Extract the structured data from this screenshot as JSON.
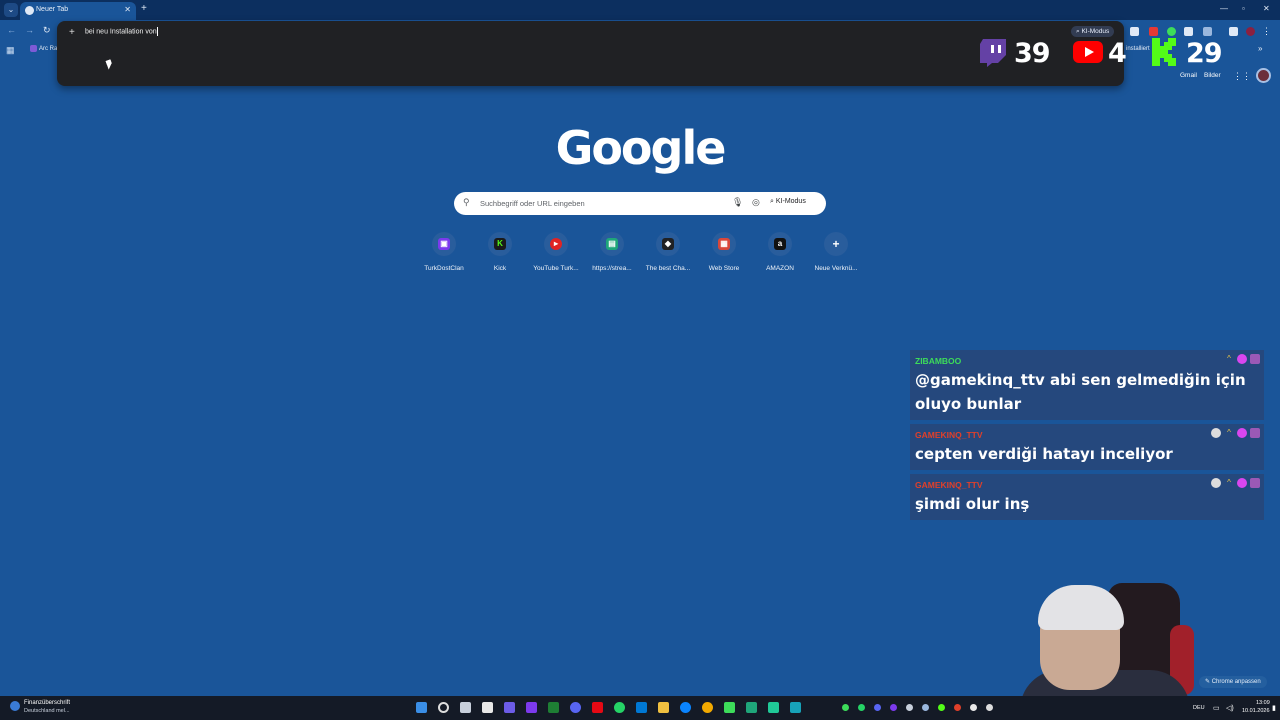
{
  "browser": {
    "tab_title": "Neuer Tab",
    "bookmark": "Arc Ra",
    "ext_text": "installiert"
  },
  "omnibox": {
    "query": "bei neu Installation von",
    "ki_mode": "KI-Modus"
  },
  "stream_counters": {
    "twitch": "39",
    "youtube": "4",
    "kick": "29"
  },
  "ntp": {
    "logo": "Google",
    "gmail": "Gmail",
    "images": "Bilder",
    "search_placeholder": "Suchbegriff oder URL eingeben",
    "ki_mode": "KI-Modus",
    "shortcuts": [
      {
        "label": "TurkDostClan",
        "icon": "twitch-icon",
        "color": "#7c3aed"
      },
      {
        "label": "Kick",
        "icon": "kick-icon",
        "color": "#1a1a1a"
      },
      {
        "label": "YouTube Turk...",
        "icon": "youtube-icon",
        "color": "#e02424"
      },
      {
        "label": "https://strea...",
        "icon": "stream-icon",
        "color": "#1fa67a"
      },
      {
        "label": "The best Cha...",
        "icon": "chat-icon",
        "color": "#202124"
      },
      {
        "label": "Web Store",
        "icon": "webstore-icon",
        "color": "#d9473a"
      },
      {
        "label": "AMAZON",
        "icon": "amazon-icon",
        "color": "#111111"
      },
      {
        "label": "Neue Verknü...",
        "icon": "plus-icon",
        "color": "transparent"
      }
    ],
    "customize": "Chrome anpassen"
  },
  "chat": [
    {
      "user": "ZIBAMBOO",
      "user_color": "#3ddc5a",
      "message": "@gamekinq_ttv abi sen gelmediğin için oluyo bunlar"
    },
    {
      "user": "GAMEKINQ_TTV",
      "user_color": "#e0402a",
      "message": "cepten verdiği hatayı inceliyor"
    },
    {
      "user": "GAMEKINQ_TTV",
      "user_color": "#e0402a",
      "message": "şimdi olur inş"
    }
  ],
  "taskbar": {
    "news_title": "Finanzüberschrift",
    "news_sub": "Deutschland mel...",
    "lang": "DEU",
    "time": "13:09",
    "date": "10.01.2026"
  },
  "icons": {
    "twitch": "twitch-icon",
    "youtube": "youtube-icon",
    "kick": "kick-icon"
  }
}
